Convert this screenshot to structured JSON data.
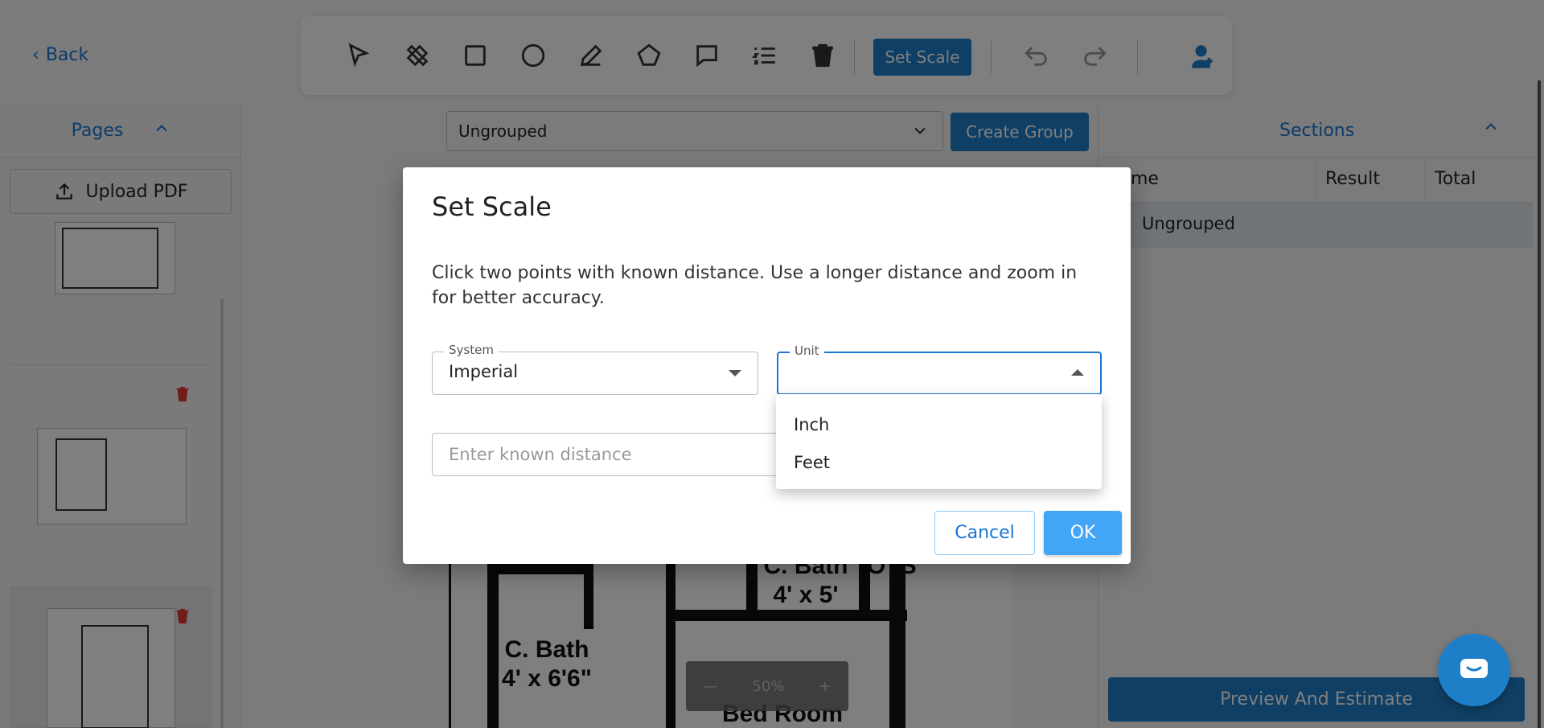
{
  "topbar": {
    "back_label": "Back",
    "set_scale_label": "Set Scale",
    "tools": [
      "select-icon",
      "eraser-icon",
      "rectangle-icon",
      "circle-icon",
      "pencil-icon",
      "polygon-icon",
      "comment-icon",
      "list-icon",
      "trash-icon",
      "undo-icon",
      "redo-icon",
      "assistant-icon"
    ]
  },
  "left_panel": {
    "title": "Pages",
    "upload_label": "Upload PDF",
    "page_count": 3
  },
  "canvas": {
    "group_select_value": "Ungrouped",
    "create_group_label": "Create Group",
    "plan_labels": {
      "bath_left": "C. Bath\n4' x 6'6\"",
      "bath_right_line": "4' x 5'",
      "bath_right_top": "C. Bath",
      "ots": "OTS",
      "bedroom": "Bed Room"
    },
    "zoom_level": "50%"
  },
  "right_panel": {
    "title": "Sections",
    "columns": [
      "me",
      "Result",
      "Total"
    ],
    "rows": [
      {
        "name": "Ungrouped",
        "result": "",
        "total": ""
      }
    ],
    "preview_label": "Preview And Estimate"
  },
  "dialog": {
    "title": "Set Scale",
    "description": "Click two points with known distance. Use a longer distance and zoom in for better accuracy.",
    "system_label": "System",
    "system_value": "Imperial",
    "unit_label": "Unit",
    "unit_value": "",
    "distance_placeholder": "Enter known distance",
    "cancel_label": "Cancel",
    "ok_label": "OK",
    "unit_options": [
      "Inch",
      "Feet"
    ]
  },
  "colors": {
    "primary": "#1e7fc9",
    "accent_text": "#1976d2",
    "ok_button": "#42a5f5",
    "trash": "#e53935"
  }
}
